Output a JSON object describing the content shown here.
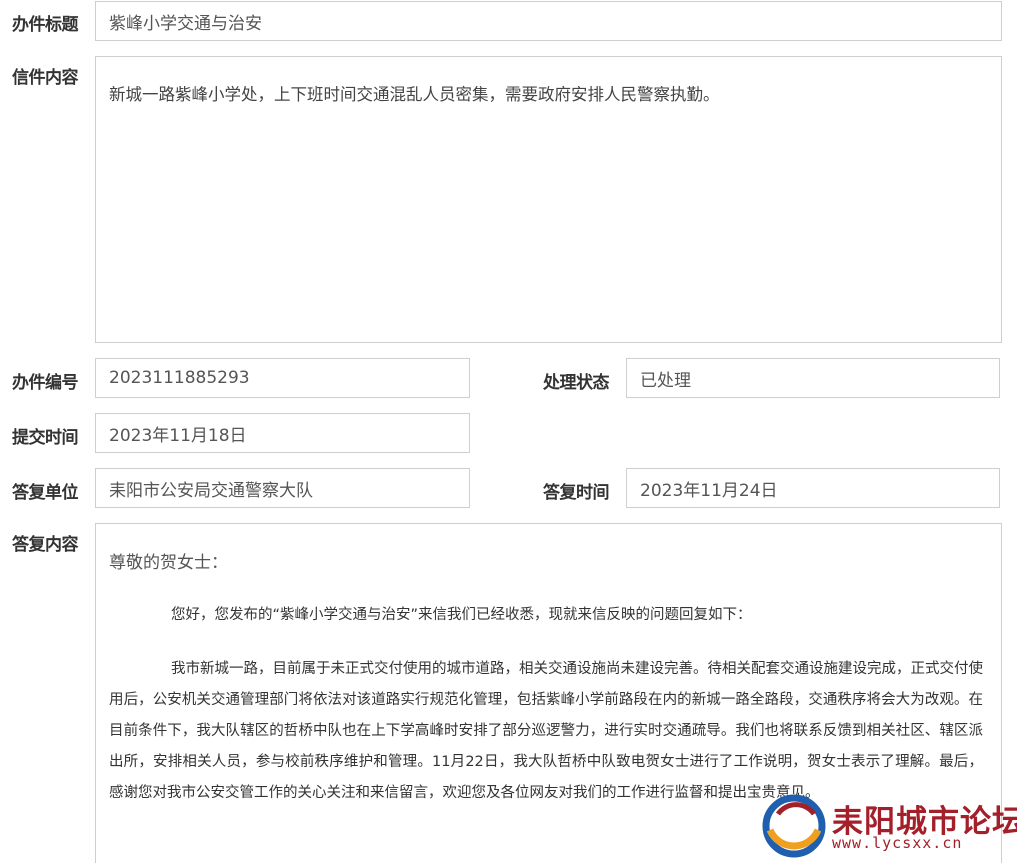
{
  "form": {
    "title_label": "办件标题",
    "title_value": "紫峰小学交通与治安",
    "content_label": "信件内容",
    "content_value": "新城一路紫峰小学处，上下班时间交通混乱人员密集，需要政府安排人民警察执勤。",
    "number_label": "办件编号",
    "number_value": "2023111885293",
    "status_label": "处理状态",
    "status_value": "已处理",
    "submit_time_label": "提交时间",
    "submit_time_value": "2023年11月18日",
    "reply_unit_label": "答复单位",
    "reply_unit_value": "耒阳市公安局交通警察大队",
    "reply_time_label": "答复时间",
    "reply_time_value": "2023年11月24日",
    "reply_content_label": "答复内容"
  },
  "reply": {
    "salutation": "尊敬的贺女士：",
    "paragraph_1": "您好，您发布的“紫峰小学交通与治安”来信我们已经收悉，现就来信反映的问题回复如下：",
    "paragraph_2": "我市新城一路，目前属于未正式交付使用的城市道路，相关交通设施尚未建设完善。待相关配套交通设施建设完成，正式交付使用后，公安机关交通管理部门将依法对该道路实行规范化管理，包括紫峰小学前路段在内的新城一路全路段，交通秩序将会大为改观。在目前条件下，我大队辖区的哲桥中队也在上下学高峰时安排了部分巡逻警力，进行实时交通疏导。我们也将联系反馈到相关社区、辖区派出所，安排相关人员，参与校前秩序维护和管理。11月22日，我大队哲桥中队致电贺女士进行了工作说明，贺女士表示了理解。最后，感谢您对我市公安交管工作的关心关注和来信留言，欢迎您及各位网友对我们的工作进行监督和提出宝贵意见。"
  },
  "watermark": {
    "name": "耒阳城市论坛",
    "url": "www.lycsxx.cn",
    "logo_icon": "forum-logo-icon",
    "colors": {
      "red": "#a31f2a",
      "blue": "#1f5fae",
      "orange": "#f0a020"
    }
  }
}
